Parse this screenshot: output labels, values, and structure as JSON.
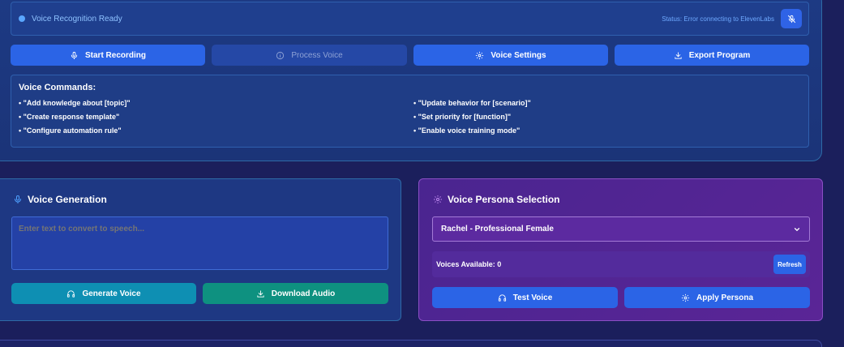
{
  "status": {
    "ready_text": "Voice Recognition Ready",
    "error_text": "Status: Error connecting to ElevenLabs",
    "mic_icon": "mic-off-icon"
  },
  "toolbar": {
    "start_recording": "Start Recording",
    "process_voice": "Process Voice",
    "voice_settings": "Voice Settings",
    "export_program": "Export Program"
  },
  "commands": {
    "title": "Voice Commands:",
    "items": [
      "• \"Add knowledge about [topic]\"",
      "• \"Update behavior for [scenario]\"",
      "• \"Create response template\"",
      "• \"Set priority for [function]\"",
      "• \"Configure automation rule\"",
      "• \"Enable voice training mode\""
    ]
  },
  "generation": {
    "title": "Voice Generation",
    "placeholder": "Enter text to convert to speech...",
    "generate_label": "Generate Voice",
    "download_label": "Download Audio"
  },
  "persona": {
    "title": "Voice Persona Selection",
    "selected": "Rachel - Professional Female",
    "voices_available": "Voices Available: 0",
    "refresh_label": "Refresh",
    "test_label": "Test Voice",
    "apply_label": "Apply Persona"
  },
  "colors": {
    "accent_blue": "#2b64e6",
    "teal": "#0e8fb3",
    "green": "#0e9180",
    "persona_purple": "#4a2590"
  }
}
